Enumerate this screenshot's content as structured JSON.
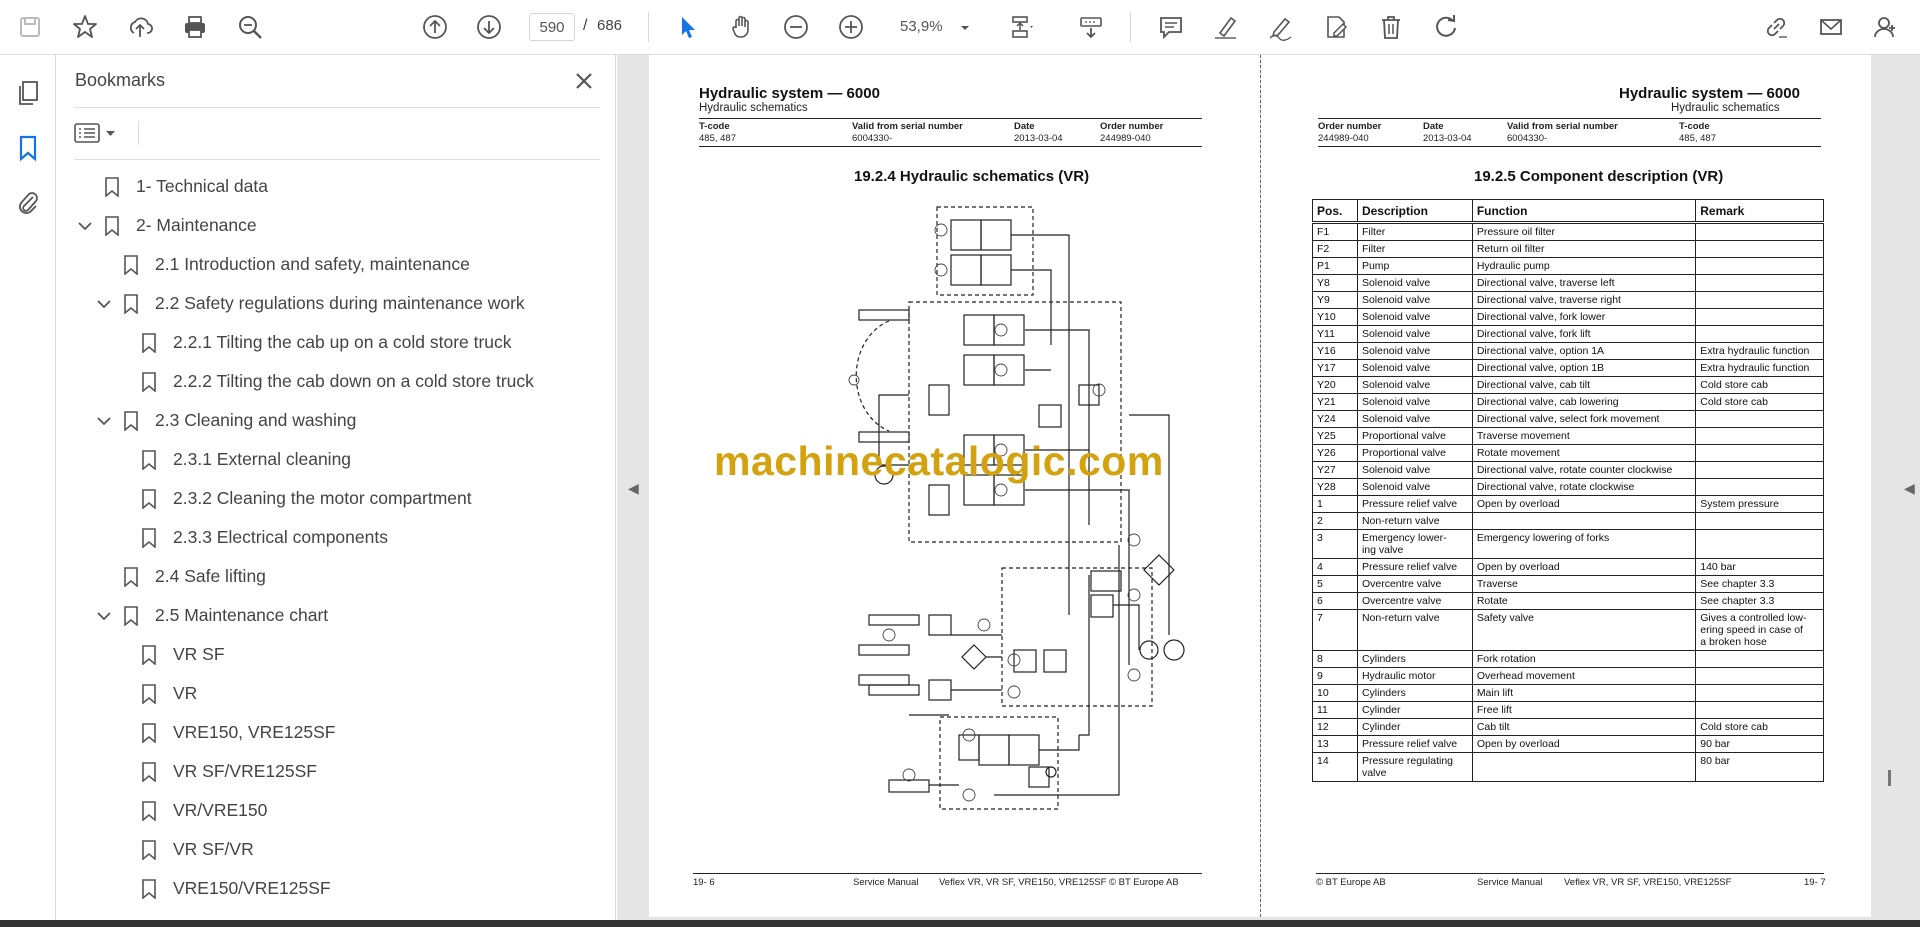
{
  "toolbar": {
    "page_current": "590",
    "page_sep": "/",
    "page_total": "686",
    "zoom": "53,9%"
  },
  "bookmarks": {
    "title": "Bookmarks",
    "items": [
      {
        "label": "1- Technical data",
        "level": 0,
        "expander": "none"
      },
      {
        "label": "2- Maintenance",
        "level": 0,
        "expander": "open"
      },
      {
        "label": "2.1 Introduction and safety, maintenance",
        "level": 1,
        "expander": "none"
      },
      {
        "label": "2.2 Safety regulations during maintenance work",
        "level": 1,
        "expander": "open"
      },
      {
        "label": "2.2.1 Tilting the cab up on a cold store truck",
        "level": 2,
        "expander": "none"
      },
      {
        "label": "2.2.2 Tilting the cab down on a cold store truck",
        "level": 2,
        "expander": "none"
      },
      {
        "label": "2.3 Cleaning and washing",
        "level": 1,
        "expander": "open"
      },
      {
        "label": "2.3.1 External cleaning",
        "level": 2,
        "expander": "none"
      },
      {
        "label": "2.3.2 Cleaning the motor compartment",
        "level": 2,
        "expander": "none"
      },
      {
        "label": "2.3.3 Electrical components",
        "level": 2,
        "expander": "none"
      },
      {
        "label": "2.4 Safe lifting",
        "level": 1,
        "expander": "none"
      },
      {
        "label": "2.5 Maintenance chart",
        "level": 1,
        "expander": "open"
      },
      {
        "label": "VR SF",
        "level": 2,
        "expander": "none"
      },
      {
        "label": "VR",
        "level": 2,
        "expander": "none"
      },
      {
        "label": "VRE150, VRE125SF",
        "level": 2,
        "expander": "none"
      },
      {
        "label": "VR SF/VRE125SF",
        "level": 2,
        "expander": "none"
      },
      {
        "label": "VR/VRE150",
        "level": 2,
        "expander": "none"
      },
      {
        "label": "VR SF/VR",
        "level": 2,
        "expander": "none"
      },
      {
        "label": "VRE150/VRE125SF",
        "level": 2,
        "expander": "none"
      }
    ]
  },
  "left_page": {
    "title": "Hydraulic system — 6000",
    "subtitle": "Hydraulic schematics",
    "meta_labels": [
      "T-code",
      "Valid from serial number",
      "Date",
      "Order number"
    ],
    "meta_values": [
      "485, 487",
      "6004330-",
      "2013-03-04",
      "244989-040"
    ],
    "section": "19.2.4 Hydraulic schematics (VR)",
    "footer_left": "19- 6",
    "footer_mid": "Service Manual",
    "footer_right": "Veflex VR, VR SF, VRE150, VRE125SF © BT Europe AB"
  },
  "right_page": {
    "title": "Hydraulic system — 6000",
    "subtitle": "Hydraulic schematics",
    "meta_labels": [
      "Order number",
      "Date",
      "Valid from serial number",
      "T-code"
    ],
    "meta_values": [
      "244989-040",
      "2013-03-04",
      "6004330-",
      "485, 487"
    ],
    "section": "19.2.5 Component description (VR)",
    "table_headers": [
      "Pos.",
      "Description",
      "Function",
      "Remark"
    ],
    "table_rows": [
      [
        "F1",
        "Filter",
        "Pressure oil filter",
        ""
      ],
      [
        "F2",
        "Filter",
        "Return oil filter",
        ""
      ],
      [
        "P1",
        "Pump",
        "Hydraulic pump",
        ""
      ],
      [
        "Y8",
        "Solenoid valve",
        "Directional valve, traverse left",
        ""
      ],
      [
        "Y9",
        "Solenoid valve",
        "Directional valve, traverse right",
        ""
      ],
      [
        "Y10",
        "Solenoid valve",
        "Directional valve, fork lower",
        ""
      ],
      [
        "Y11",
        "Solenoid valve",
        "Directional valve, fork lift",
        ""
      ],
      [
        "Y16",
        "Solenoid valve",
        "Directional valve, option 1A",
        "Extra hydraulic function"
      ],
      [
        "Y17",
        "Solenoid valve",
        "Directional valve, option 1B",
        "Extra hydraulic function"
      ],
      [
        "Y20",
        "Solenoid valve",
        "Directional valve, cab tilt",
        "Cold store cab"
      ],
      [
        "Y21",
        "Solenoid valve",
        "Directional valve, cab lowering",
        "Cold store cab"
      ],
      [
        "Y24",
        "Solenoid valve",
        "Directional valve, select fork movement",
        ""
      ],
      [
        "Y25",
        "Proportional valve",
        "Traverse movement",
        ""
      ],
      [
        "Y26",
        "Proportional valve",
        "Rotate movement",
        ""
      ],
      [
        "Y27",
        "Solenoid valve",
        "Directional valve, rotate counter clockwise",
        ""
      ],
      [
        "Y28",
        "Solenoid valve",
        "Directional valve, rotate clockwise",
        ""
      ],
      [
        "1",
        "Pressure relief valve",
        "Open by overload",
        "System pressure"
      ],
      [
        "2",
        "Non-return valve",
        "",
        ""
      ],
      [
        "3",
        "Emergency lower-\ning valve",
        "Emergency lowering of forks",
        ""
      ],
      [
        "4",
        "Pressure relief valve",
        "Open by overload",
        "140 bar"
      ],
      [
        "5",
        "Overcentre valve",
        "Traverse",
        "See chapter 3.3"
      ],
      [
        "6",
        "Overcentre valve",
        "Rotate",
        "See chapter 3.3"
      ],
      [
        "7",
        "Non-return valve",
        "Safety valve",
        "Gives a controlled low-\nering speed in case of\na broken hose"
      ],
      [
        "8",
        "Cylinders",
        "Fork rotation",
        ""
      ],
      [
        "9",
        "Hydraulic motor",
        "Overhead movement",
        ""
      ],
      [
        "10",
        "Cylinders",
        "Main lift",
        ""
      ],
      [
        "11",
        "Cylinder",
        "Free lift",
        ""
      ],
      [
        "12",
        "Cylinder",
        "Cab tilt",
        "Cold store cab"
      ],
      [
        "13",
        "Pressure relief valve",
        "Open by overload",
        "90 bar"
      ],
      [
        "14",
        "Pressure regulating\nvalve",
        "",
        "80 bar"
      ]
    ],
    "footer_left": "© BT Europe AB",
    "footer_mid": "Service Manual",
    "footer_right": "Veflex VR, VR SF, VRE150, VRE125SF",
    "footer_page": "19- 7"
  },
  "watermark": "machinecatalogic.com",
  "colors": {
    "accent": "#1473e6",
    "watermark": "#d4a20f"
  }
}
